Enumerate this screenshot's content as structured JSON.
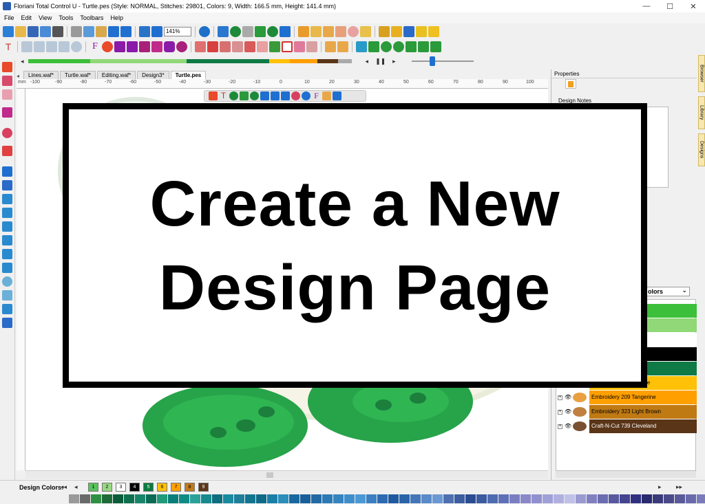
{
  "window": {
    "title": "Floriani Total Control U - Turtle.pes (Style: NORMAL, Stitches: 29801, Colors: 9, Width: 166.5 mm, Height: 141.4 mm)",
    "controls": [
      "—",
      "☐",
      "✕"
    ]
  },
  "menu": [
    "File",
    "Edit",
    "View",
    "Tools",
    "Toolbars",
    "Help"
  ],
  "toolbar": {
    "zoom": "141%"
  },
  "tabs": [
    {
      "label": "Lines.waf*",
      "active": false
    },
    {
      "label": "Turtle.waf*",
      "active": false
    },
    {
      "label": "Editing.waf*",
      "active": false
    },
    {
      "label": "Design3*",
      "active": false
    },
    {
      "label": "Turtle.pes",
      "active": true
    }
  ],
  "ruler": {
    "unit": "mm",
    "ticks": [
      "-100",
      "-90",
      "-80",
      "-70",
      "-60",
      "-50",
      "-40",
      "-30",
      "-20",
      "-10",
      "0",
      "10",
      "20",
      "30",
      "40",
      "50",
      "60",
      "70",
      "80",
      "90",
      "100"
    ]
  },
  "overlay": {
    "line1": "Create a New",
    "line2": "Design Page"
  },
  "properties": {
    "header": "Properties",
    "notes_label": "Design Notes"
  },
  "colors_panel": {
    "selected_view": "olors",
    "rows": [
      {
        "label": "",
        "color": "#3cbf3a"
      },
      {
        "label": "",
        "color": "#90d878"
      },
      {
        "label": "",
        "color": "#ffffff"
      },
      {
        "label": "",
        "color": "#000000"
      },
      {
        "label": "",
        "color": "#0f7a45"
      },
      {
        "label": "Embroidery 208 Orange",
        "color": "#ffc107"
      },
      {
        "label": "Embroidery 209 Tangerine",
        "color": "#ff9f00"
      },
      {
        "label": "Embroidery 323 Light Brown",
        "color": "#c07a14"
      },
      {
        "label": "Craft-N-Cut 739 Cleveland",
        "color": "#5a3518"
      }
    ]
  },
  "side_tabs": [
    "Browser",
    "Library",
    "Designs"
  ],
  "design_colors": {
    "label": "Design Colors:",
    "swatches": [
      {
        "n": "1",
        "color": "#56c35a"
      },
      {
        "n": "2",
        "color": "#98d884"
      },
      {
        "n": "3",
        "color": "#ffffff"
      },
      {
        "n": "4",
        "color": "#000000"
      },
      {
        "n": "5",
        "color": "#0c7a3f"
      },
      {
        "n": "6",
        "color": "#ffc107"
      },
      {
        "n": "7",
        "color": "#ffa000"
      },
      {
        "n": "8",
        "color": "#c27a1a"
      },
      {
        "n": "9",
        "color": "#5b3618"
      }
    ]
  },
  "palette": [
    "#9a9a9a",
    "#6a6a6a",
    "#2f8f43",
    "#1e6b3a",
    "#0b5c3a",
    "#0f7050",
    "#18856a",
    "#0b6b55",
    "#1f9a7a",
    "#0a7e78",
    "#0f8b85",
    "#2aa09a",
    "#168a8e",
    "#0b6f80",
    "#1a8aa0",
    "#1e7f9b",
    "#127590",
    "#0e6a88",
    "#1a7fa8",
    "#2b8ebb",
    "#1868a0",
    "#1a5f9a",
    "#236aa5",
    "#2c7ab5",
    "#3584c0",
    "#3f8ecc",
    "#4a98d6",
    "#3b7fc0",
    "#2d6aaf",
    "#1f5aa0",
    "#2a63a8",
    "#4276b8",
    "#5a8ac8",
    "#6a98d2",
    "#4e6fb0",
    "#3a5ea0",
    "#2a4c90",
    "#3c5aa0",
    "#4e6cb0",
    "#6070b8",
    "#7a7ec0",
    "#8a88c8",
    "#9090d0",
    "#a0a0d8",
    "#b0b0e0",
    "#c0c0e8",
    "#9a9ad0",
    "#8080c0",
    "#6c6cb0",
    "#5858a0",
    "#444490",
    "#303080",
    "#2a2a70",
    "#3a3a7a",
    "#4a4a8a",
    "#5a5a9a",
    "#6a6aaa",
    "#7a7aba"
  ]
}
